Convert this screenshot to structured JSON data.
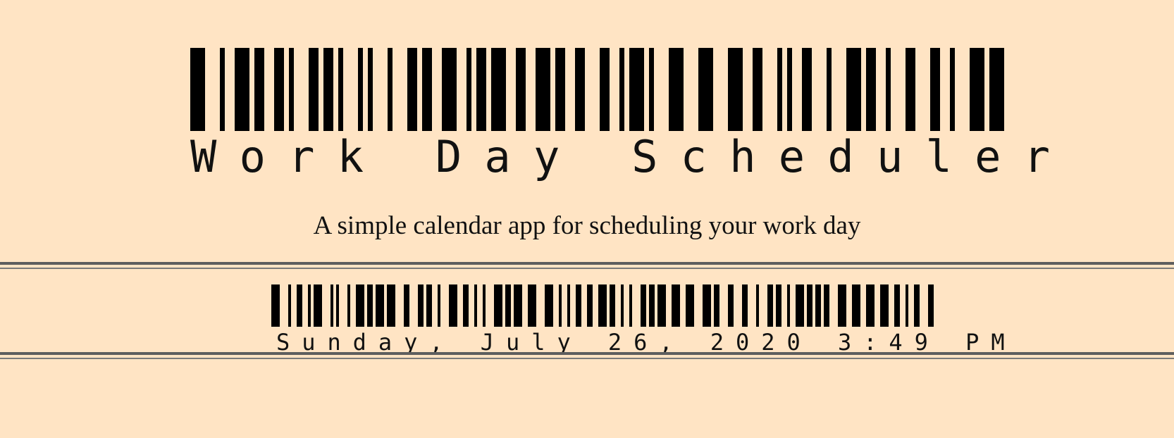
{
  "page": {
    "background": "#FFE4C4",
    "ink": "#000000",
    "rule_color": "#5E5E5E"
  },
  "header": {
    "title": "Work Day Scheduler",
    "lead": "A simple calendar app for scheduling your work day"
  },
  "current_day": {
    "text": "Sunday, July 26, 2020 3:49 PM"
  }
}
